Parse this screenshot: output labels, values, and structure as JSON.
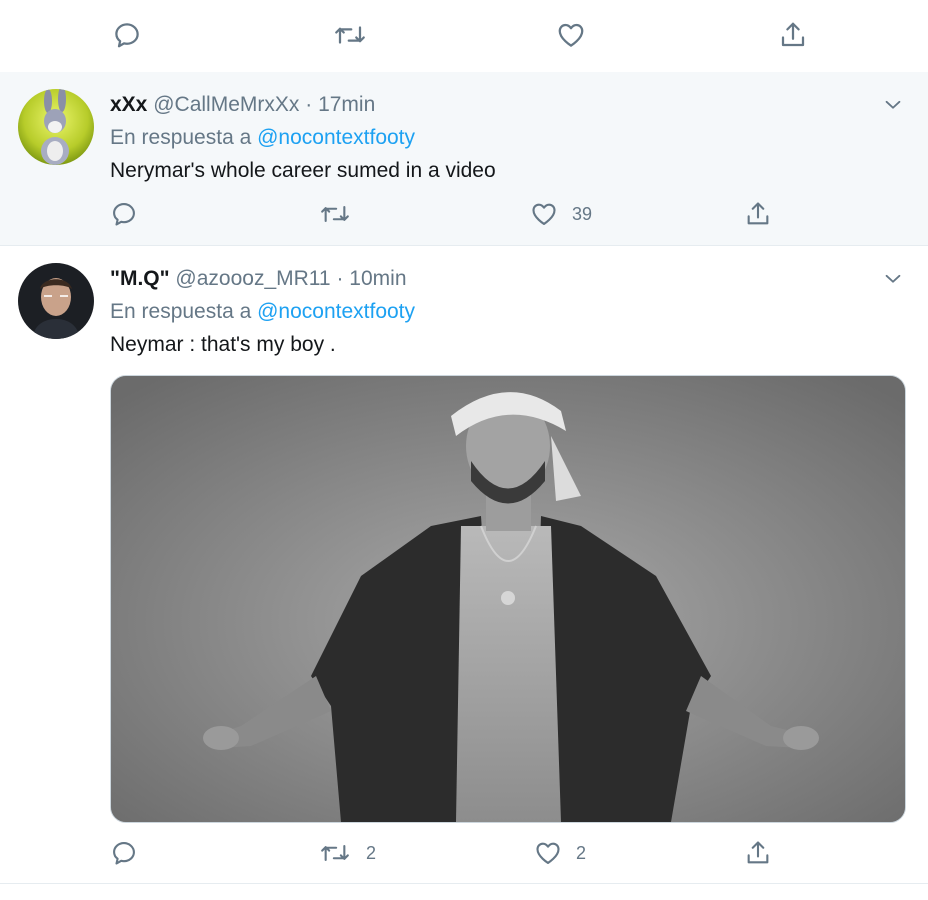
{
  "top_actions": {
    "reply_icon": "reply-icon",
    "retweet_icon": "retweet-icon",
    "like_icon": "heart-icon",
    "share_icon": "share-icon"
  },
  "tweets": [
    {
      "name": "xXx",
      "handle": "@CallMeMrxXx",
      "separator": "·",
      "time": "17min",
      "reply_prefix": "En respuesta a",
      "reply_to": "@nocontextfooty",
      "text": "Nerymar's whole career sumed in a video",
      "retweets": "",
      "likes": "39"
    },
    {
      "name": "\"M.Q\"",
      "handle": "@azoooz_MR11",
      "separator": "·",
      "time": "10min",
      "reply_prefix": "En respuesta a",
      "reply_to": "@nocontextfooty",
      "text": "Neymar : that's my boy .",
      "retweets": "2",
      "likes": "2"
    }
  ],
  "colors": {
    "accent": "#1da1f2",
    "secondary_text": "#657786",
    "highlight_bg": "#f5f8fa",
    "border": "#e6ecf0"
  }
}
